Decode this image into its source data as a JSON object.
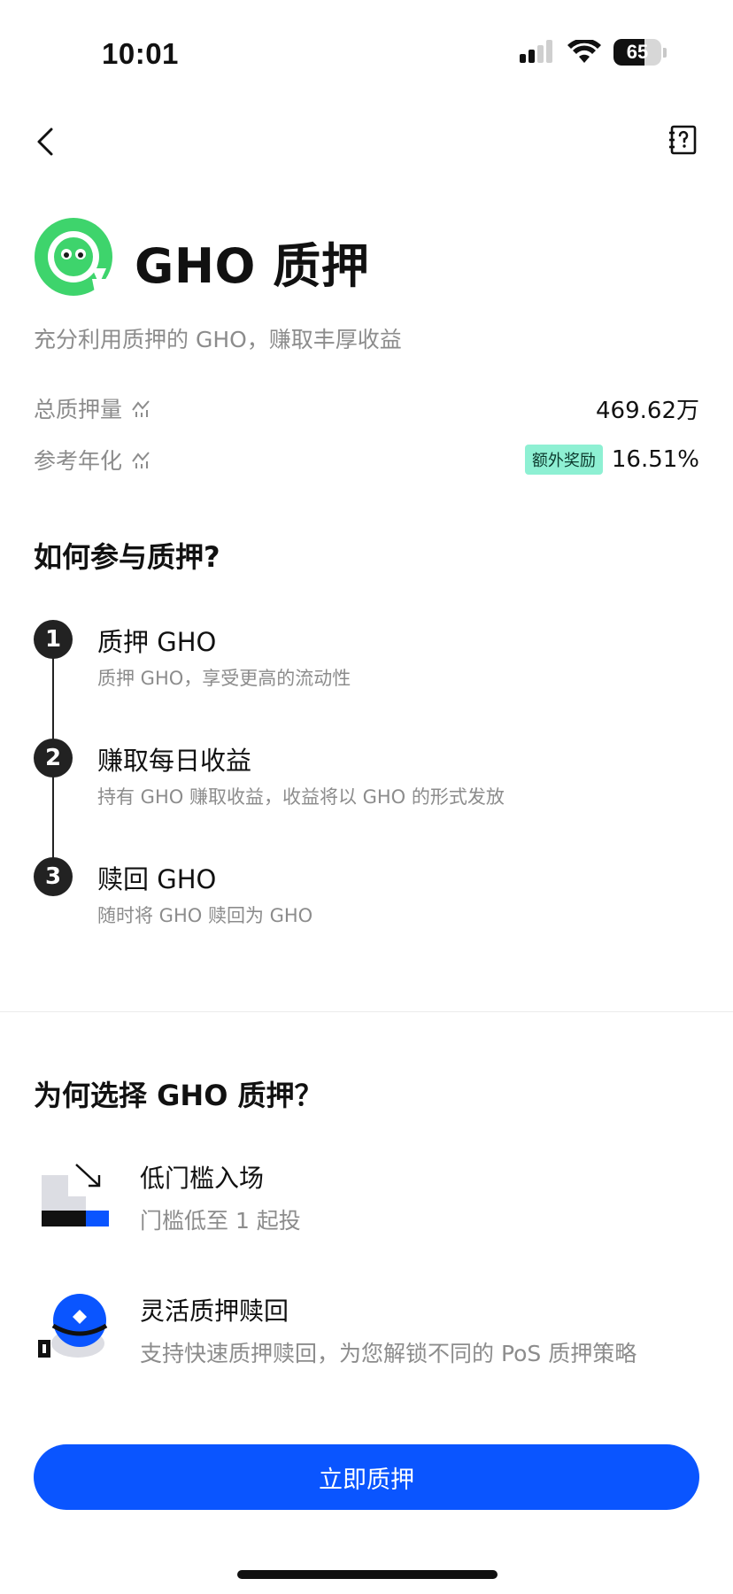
{
  "status_bar": {
    "time": "10:01",
    "battery_level": "65",
    "battery_fraction": 0.65
  },
  "header": {
    "title": "GHO 质押",
    "subtitle": "充分利用质押的 GHO，赚取丰厚收益",
    "logo_color": "#3ed46c"
  },
  "stats": {
    "total_staked_label": "总质押量",
    "total_staked_value": "469.62万",
    "apr_label": "参考年化",
    "apr_badge": "额外奖励",
    "apr_value": "16.51%",
    "chart_icon": "chart-icon"
  },
  "how_section": {
    "title": "如何参与质押?",
    "steps": [
      {
        "number": "1",
        "title": "质押 GHO",
        "desc": "质押 GHO，享受更高的流动性"
      },
      {
        "number": "2",
        "title": "赚取每日收益",
        "desc": "持有 GHO 赚取收益，收益将以 GHO 的形式发放"
      },
      {
        "number": "3",
        "title": "赎回 GHO",
        "desc": "随时将 GHO 赎回为 GHO"
      }
    ]
  },
  "why_section": {
    "title": "为何选择 GHO 质押？",
    "features": [
      {
        "title": "低门槛入场",
        "desc": "门槛低至 1 起投",
        "icon": "low-threshold-icon"
      },
      {
        "title": "灵活质押赎回",
        "desc": "支持快速质押赎回，为您解锁不同的 PoS 质押策略",
        "icon": "flexible-redeem-icon"
      }
    ]
  },
  "cta": {
    "label": "立即质押"
  },
  "colors": {
    "primary": "#0a55ff",
    "badge": "#8ef0d3",
    "muted_text": "#8c8c8c",
    "logo": "#3ed46c"
  }
}
